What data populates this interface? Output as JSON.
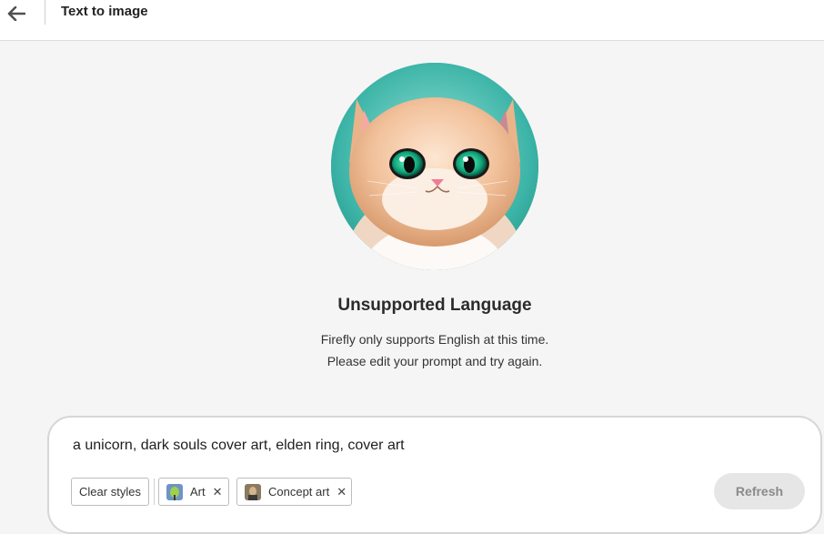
{
  "header": {
    "back_icon": "arrow-left-icon",
    "title": "Text to image"
  },
  "result": {
    "image_subject": "fluffy cartoon kitten with green eyes",
    "error_title": "Unsupported Language",
    "error_line1": "Firefly only supports English at this time.",
    "error_line2": "Please edit your prompt and try again."
  },
  "prompt": {
    "text": "a unicorn, dark souls cover art, elden ring, cover art",
    "clear_styles_label": "Clear styles",
    "chips": [
      {
        "label": "Art",
        "remove_icon": "close-icon"
      },
      {
        "label": "Concept art",
        "remove_icon": "close-icon"
      }
    ],
    "refresh_label": "Refresh"
  },
  "colors": {
    "background": "#f5f5f5",
    "refresh_disabled_bg": "#e6e6e6",
    "refresh_disabled_text": "#8a8a8a"
  }
}
